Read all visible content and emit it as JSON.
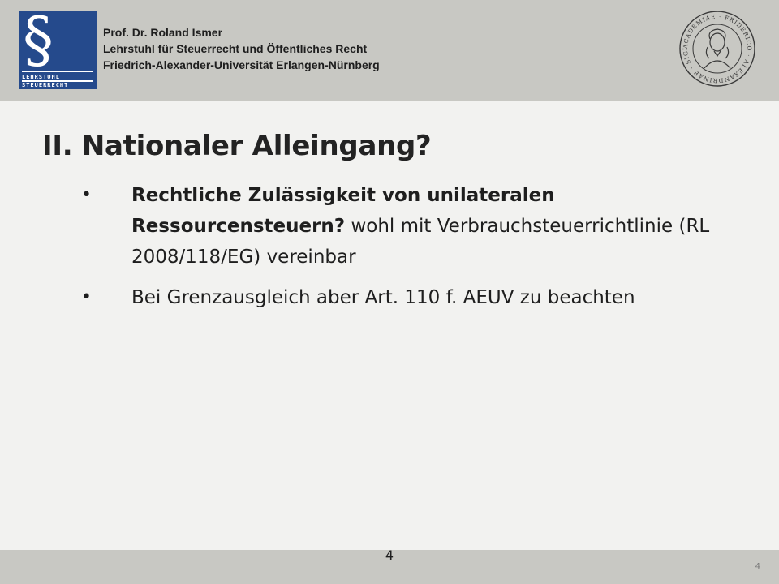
{
  "header": {
    "logo": {
      "symbol": "§",
      "line1": "LEHRSTUHL",
      "line2": "STEUERRECHT"
    },
    "lines": [
      "Prof. Dr. Roland Ismer",
      "Lehrstuhl für Steuerrecht und Öffentliches Recht",
      "Friedrich-Alexander-Universität Erlangen-Nürnberg"
    ],
    "seal": {
      "icon": "university-seal-icon",
      "text": "ACADEMIAE · FRIDERICO · ALEXANDRINAE · SIGILLUM ·"
    }
  },
  "slide": {
    "title": "II. Nationaler Alleingang?",
    "bullets": [
      {
        "bold": "Rechtliche Zulässigkeit von unilateralen Ressourcensteuern?",
        "rest": " wohl mit Verbrauchsteuerrichtlinie (RL 2008/118/EG) vereinbar"
      },
      {
        "bold": "",
        "rest": "Bei Grenzausgleich aber Art. 110 f. AEUV zu beachten"
      }
    ],
    "bullet_symbol": "•"
  },
  "footer": {
    "page_number": "4",
    "page_number_small": "4"
  },
  "colors": {
    "header_band": "#c8c8c3",
    "logo_blue": "#254a8c",
    "background": "#f2f2f0"
  }
}
